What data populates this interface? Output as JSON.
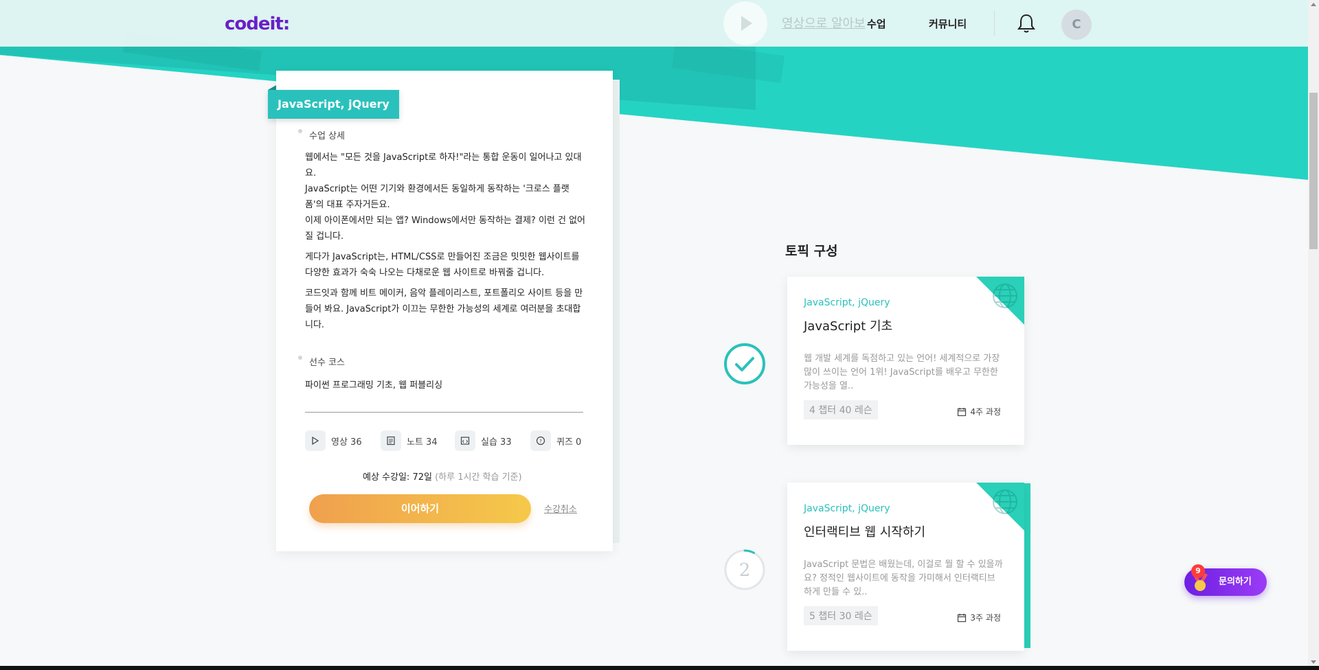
{
  "header": {
    "logo": "codeit:",
    "ghost_text": "영상으로 알아보",
    "nav": [
      "수업",
      "커뮤니티"
    ],
    "avatar_initial": "C"
  },
  "course": {
    "tag": "JavaScript, jQuery",
    "detail_title": "수업 상세",
    "description": [
      "웹에서는 \"모든 것을 JavaScript로 하자!\"라는 통합 운동이 일어나고 있대요.\nJavaScript는 어떤 기기와 환경에서든 동일하게 동작하는 '크로스 플랫폼'의 대표 주자거든요.\n이제 아이폰에서만 되는 앱? Windows에서만 동작하는 결제? 이런 건 없어질 겁니다.",
      "게다가 JavaScript는, HTML/CSS로 만들어진 조금은 밋밋한 웹사이트를 다양한 효과가 숙숙 나오는 다채로운 웹 사이트로 바꿔줄 겁니다.",
      "코드잇과 함께 비트 메이커, 음악 플레이리스트, 포트폴리오 사이트 등을 만들어 봐요. JavaScript가 이끄는 무한한 가능성의 세계로 여러분을 초대합니다."
    ],
    "prereq_title": "선수 코스",
    "prereq": "파이썬 프로그래밍 기초, 웹 퍼블리싱",
    "stats": [
      {
        "icon": "play-icon",
        "label": "영상 36"
      },
      {
        "icon": "note-icon",
        "label": "노트 34"
      },
      {
        "icon": "code-icon",
        "label": "실습 33"
      },
      {
        "icon": "quiz-icon",
        "label": "퀴즈 0"
      }
    ],
    "estimate_main": "예상 수강일: 72일",
    "estimate_sub": "(하루 1시간 학습 기준)",
    "continue_label": "이어하기",
    "cancel_label": "수강취소"
  },
  "topics": {
    "title": "토픽 구성",
    "items": [
      {
        "category": "JavaScript, jQuery",
        "name": "JavaScript 기초",
        "desc": "웹 개발 세계를 독점하고 있는 언어! 세계적으로 가장 많이 쓰이는 언어 1위! JavaScript를 배우고 무한한 가능성을 열..",
        "count": "4 챕터 40 레슨",
        "weeks": "4주 과정",
        "status": "done"
      },
      {
        "category": "JavaScript, jQuery",
        "name": "인터랙티브 웹 시작하기",
        "desc": "JavaScript 문법은 배웠는데, 이걸로 뭘 할 수 있을까요? 정적인 웹사이트에 동작을 가미해서 인터랙티브하게 만들 수 있..",
        "count": "5 챕터 30 레슨",
        "weeks": "3주 과정",
        "status": "2",
        "progress": 0.08
      }
    ]
  },
  "chat": {
    "label": "문의하기",
    "badge": "9"
  },
  "colors": {
    "teal": "#2ac1bc",
    "purple": "#6a1fc7",
    "orange": "#f0a04e"
  }
}
